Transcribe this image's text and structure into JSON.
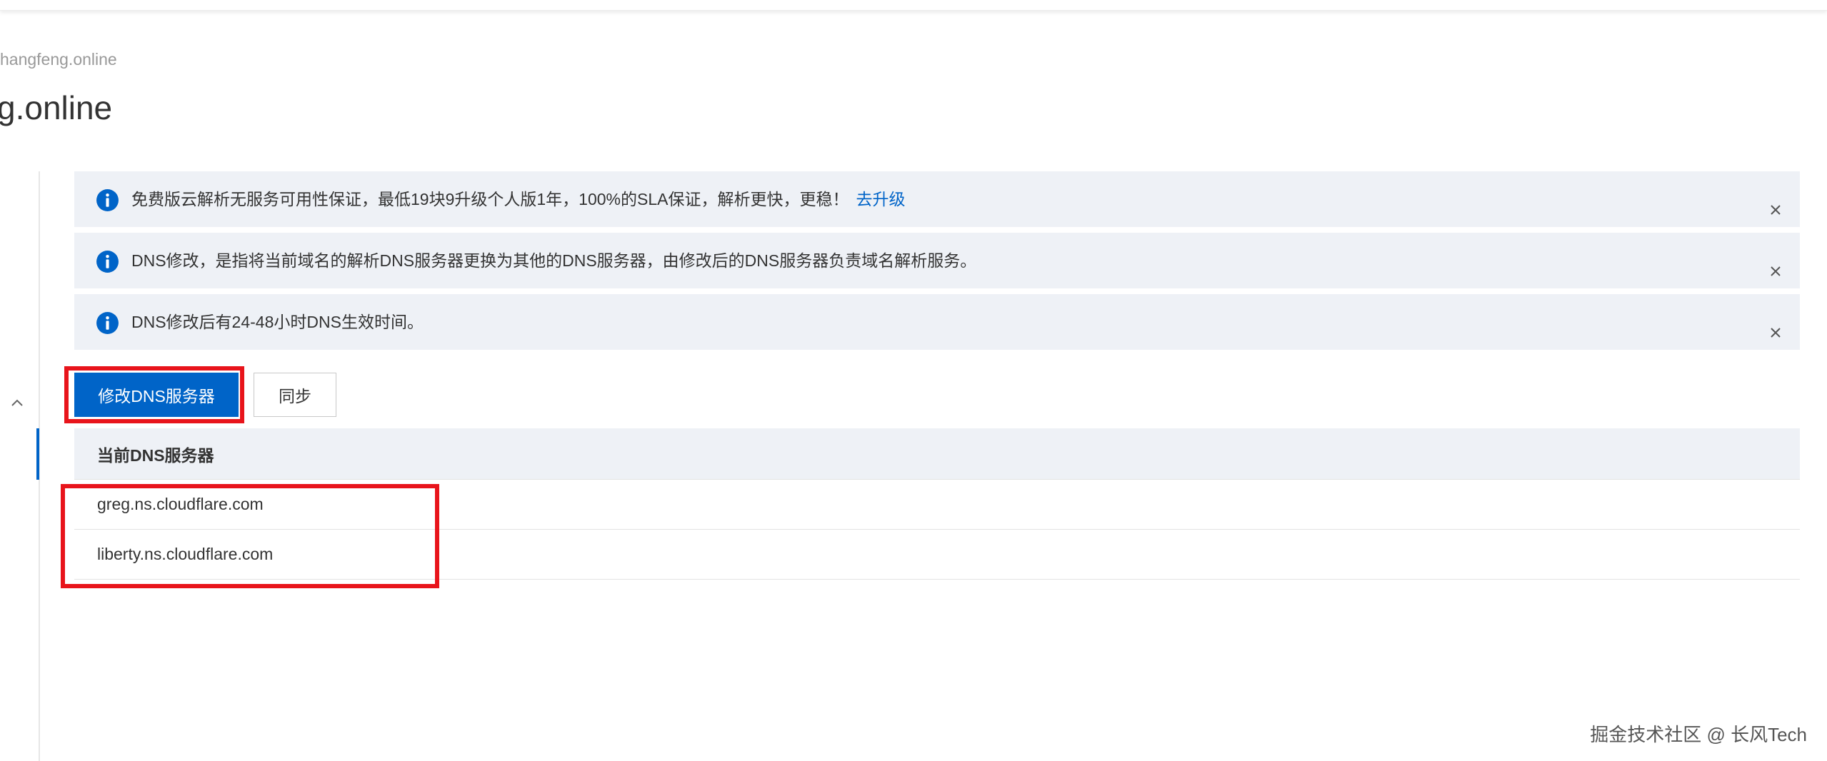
{
  "header": {
    "breadcrumb": "hangfeng.online",
    "title": "g.online"
  },
  "notices": [
    {
      "text": "免费版云解析无服务可用性保证，最低19块9升级个人版1年，100%的SLA保证，解析更快，更稳！",
      "link": "去升级"
    },
    {
      "text": "DNS修改，是指将当前域名的解析DNS服务器更换为其他的DNS服务器，由修改后的DNS服务器负责域名解析服务。"
    },
    {
      "text": "DNS修改后有24-48小时DNS生效时间。"
    }
  ],
  "toolbar": {
    "modify_label": "修改DNS服务器",
    "sync_label": "同步"
  },
  "table": {
    "header": "当前DNS服务器",
    "rows": [
      "greg.ns.cloudflare.com",
      "liberty.ns.cloudflare.com"
    ]
  },
  "watermark": "掘金技术社区 @ 长风Tech",
  "colors": {
    "primary": "#0064c8",
    "notice_bg": "#eef1f6",
    "highlight": "#e8141b"
  },
  "icons": {
    "info": "info-icon",
    "close": "close-icon",
    "collapse": "chevron-up-icon"
  }
}
